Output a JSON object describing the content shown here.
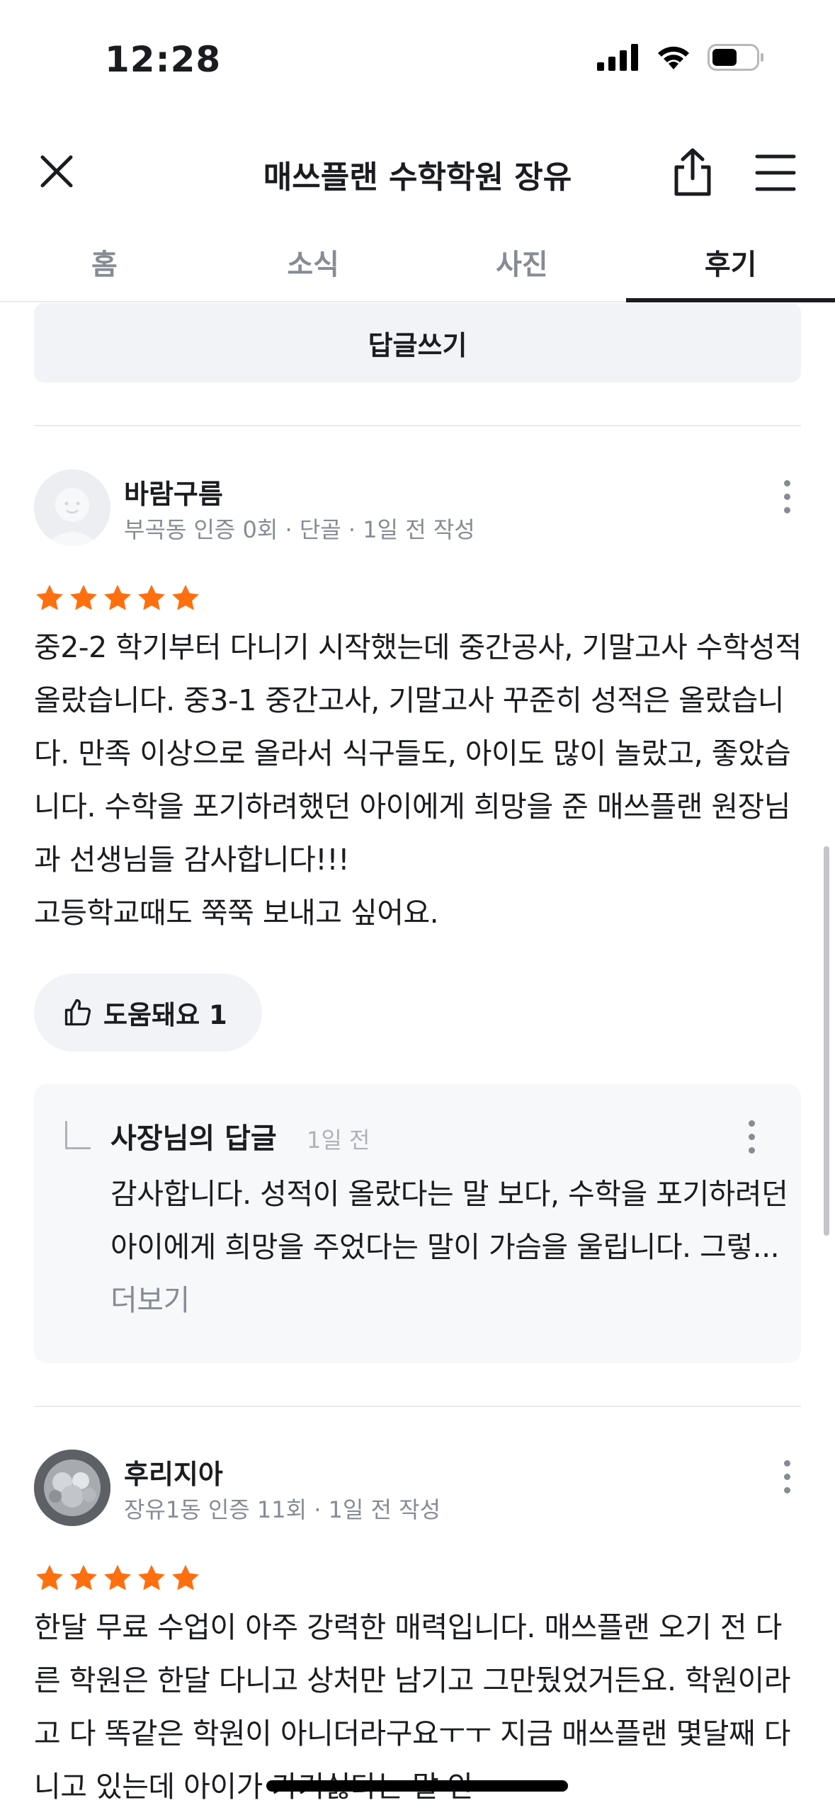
{
  "status": {
    "time": "12:28"
  },
  "header": {
    "title": "매쓰플랜 수학학원 장유"
  },
  "tabs": [
    {
      "label": "홈"
    },
    {
      "label": "소식"
    },
    {
      "label": "사진"
    },
    {
      "label": "후기"
    }
  ],
  "active_tab": "후기",
  "reply_write_label": "답글쓰기",
  "reviews": [
    {
      "name": "바람구름",
      "meta": "부곡동 인증 0회 · 단골 · 1일 전 작성",
      "rating": 5,
      "text": "중2-2 학기부터 다니기 시작했는데 중간공사, 기말고사 수학성적 올랐습니다. 중3-1 중간고사, 기말고사 꾸준히 성적은 올랐습니다. 만족 이상으로 올라서 식구들도, 아이도 많이 놀랐고, 좋았습니다. 수학을 포기하려했던 아이에게 희망을 준 매쓰플랜 원장님과 선생님들 감사합니다!!!",
      "text2": "고등학교때도 쭉쭉 보내고 싶어요.",
      "helpful_label": "도움돼요 1",
      "owner_reply": {
        "title": "사장님의 답글",
        "date": "1일 전",
        "text": "감사합니다. 성적이 올랐다는 말 보다, 수학을 포기하려던 아이에게 희망을 주었다는 말이 가슴을 울립니다. 그렇... ",
        "more": "더보기"
      }
    },
    {
      "name": "후리지아",
      "meta": "장유1동 인증 11회 · 1일 전 작성",
      "rating": 5,
      "text": "한달 무료 수업이 아주 강력한 매력입니다. 매쓰플랜 오기 전 다른 학원은 한달 다니고 상처만 남기고 그만뒀었거든요. 학원이라고 다 똑같은 학원이 아니더라구요ㅜㅜ 지금 매쓰플랜 몇달째 다니고 있는데 아이가 가기싫다는 말 안"
    }
  ],
  "colors": {
    "star": "#ff6f0f",
    "text": "#1a1c20",
    "muted": "#868b94",
    "surface": "#f2f3f6"
  }
}
